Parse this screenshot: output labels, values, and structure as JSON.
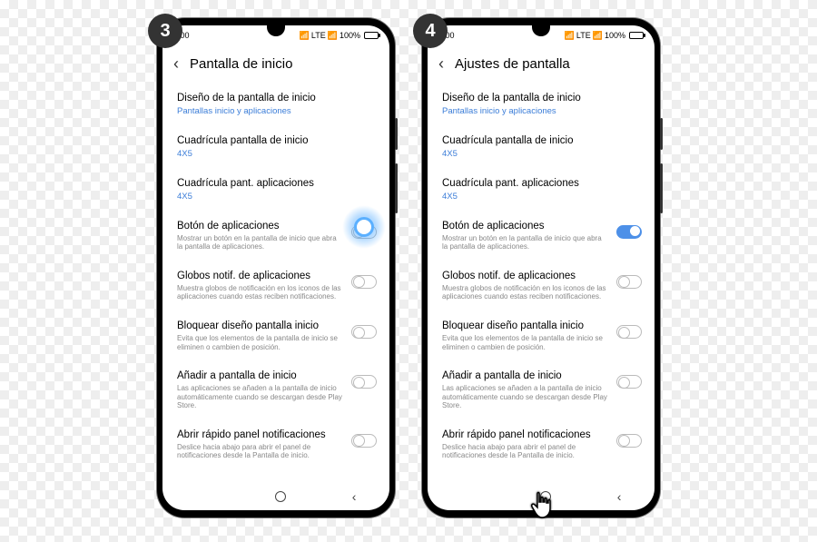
{
  "steps": [
    {
      "badge": "3",
      "headerTitle": "Pantalla de inicio",
      "highlightToggle": true,
      "showCursor": false,
      "appsToggleOn": false
    },
    {
      "badge": "4",
      "headerTitle": "Ajustes de pantalla",
      "highlightToggle": false,
      "showCursor": true,
      "appsToggleOn": true
    }
  ],
  "status": {
    "time": "9:00",
    "network": "LTE",
    "signal": "▮▯",
    "battery": "100%"
  },
  "items": {
    "layout": {
      "title": "Diseño de la pantalla de inicio",
      "value": "Pantallas inicio y aplicaciones"
    },
    "homeGrid": {
      "title": "Cuadrícula pantalla de inicio",
      "value": "4X5"
    },
    "appsGrid": {
      "title": "Cuadrícula pant. aplicaciones",
      "value": "4X5"
    },
    "appsButton": {
      "title": "Botón de aplicaciones",
      "desc": "Mostrar un botón en la pantalla de inicio que abra la pantalla de aplicaciones."
    },
    "badges": {
      "title": "Globos notif. de aplicaciones",
      "desc": "Muestra globos de notificación en los iconos de las aplicaciones cuando estas reciben notificaciones."
    },
    "lock": {
      "title": "Bloquear diseño pantalla inicio",
      "desc": "Evita que los elementos de la pantalla de inicio se eliminen o cambien de posición."
    },
    "addHome": {
      "title": "Añadir a pantalla de inicio",
      "desc": "Las aplicaciones se añaden a la pantalla de inicio automáticamente cuando se descargan desde Play Store."
    },
    "quickPanel": {
      "title": "Abrir rápido panel notificaciones",
      "desc": "Deslice hacia abajo para abrir el panel de notificaciones desde la Pantalla de inicio."
    }
  }
}
